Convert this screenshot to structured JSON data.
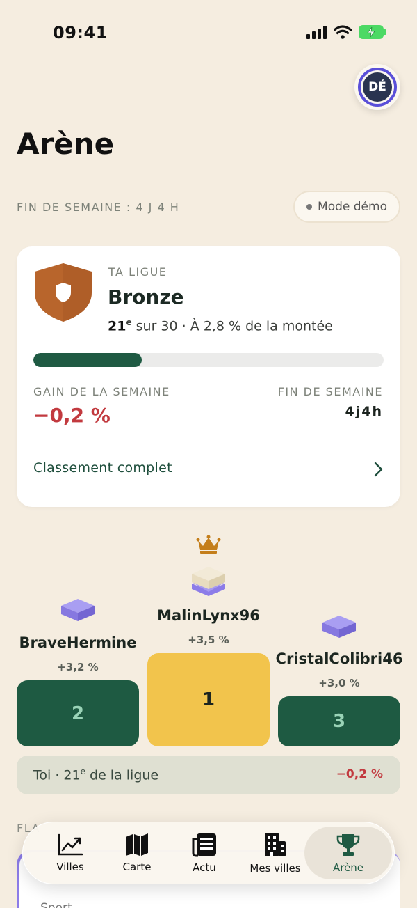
{
  "status": {
    "time": "09:41"
  },
  "avatar": {
    "initials": "DÉ"
  },
  "page": {
    "title": "Arène"
  },
  "week_end_banner": "FIN DE SEMAINE : 4 J 4 H",
  "mode_demo": "Mode démo",
  "league": {
    "section_label": "TA LIGUE",
    "name": "Bronze",
    "rank": "21",
    "rank_suffix": "e",
    "rank_rest": " sur 30 · À 2,8 % de la montée",
    "progress_fraction": 0.31,
    "gain_label": "GAIN DE LA SEMAINE",
    "gain_value": "−0,2 %",
    "end_label": "FIN DE SEMAINE",
    "end_value": "4j4h",
    "full_ranking": "Classement complet"
  },
  "podium": {
    "first": {
      "name": "MalinLynx96",
      "gain": "+3,5 %",
      "rank": "1"
    },
    "second": {
      "name": "BraveHermine",
      "gain": "+3,2 %",
      "rank": "2"
    },
    "third": {
      "name": "CristalColibri46",
      "gain": "+3,0 %",
      "rank": "3"
    }
  },
  "me": {
    "label": "Toi",
    "rank_prefix": " · 21",
    "rank_suffix": "e",
    "rank_rest": " de la ligue",
    "gain": "−0,2 %"
  },
  "next_section": {
    "label_partial": "FLA",
    "item": "Sport"
  },
  "tabs": [
    {
      "label": "Villes",
      "icon": "chart-up-icon"
    },
    {
      "label": "Carte",
      "icon": "map-icon"
    },
    {
      "label": "Actu",
      "icon": "newspaper-icon"
    },
    {
      "label": "Mes villes",
      "icon": "buildings-icon"
    },
    {
      "label": "Arène",
      "icon": "trophy-icon",
      "active": true
    }
  ],
  "colors": {
    "background": "#f5ede0",
    "accent_green": "#1f5a43",
    "gold": "#f2c44c",
    "negative": "#c23a3f",
    "bronze": "#b8652c",
    "purple": "#8c7ce8"
  }
}
